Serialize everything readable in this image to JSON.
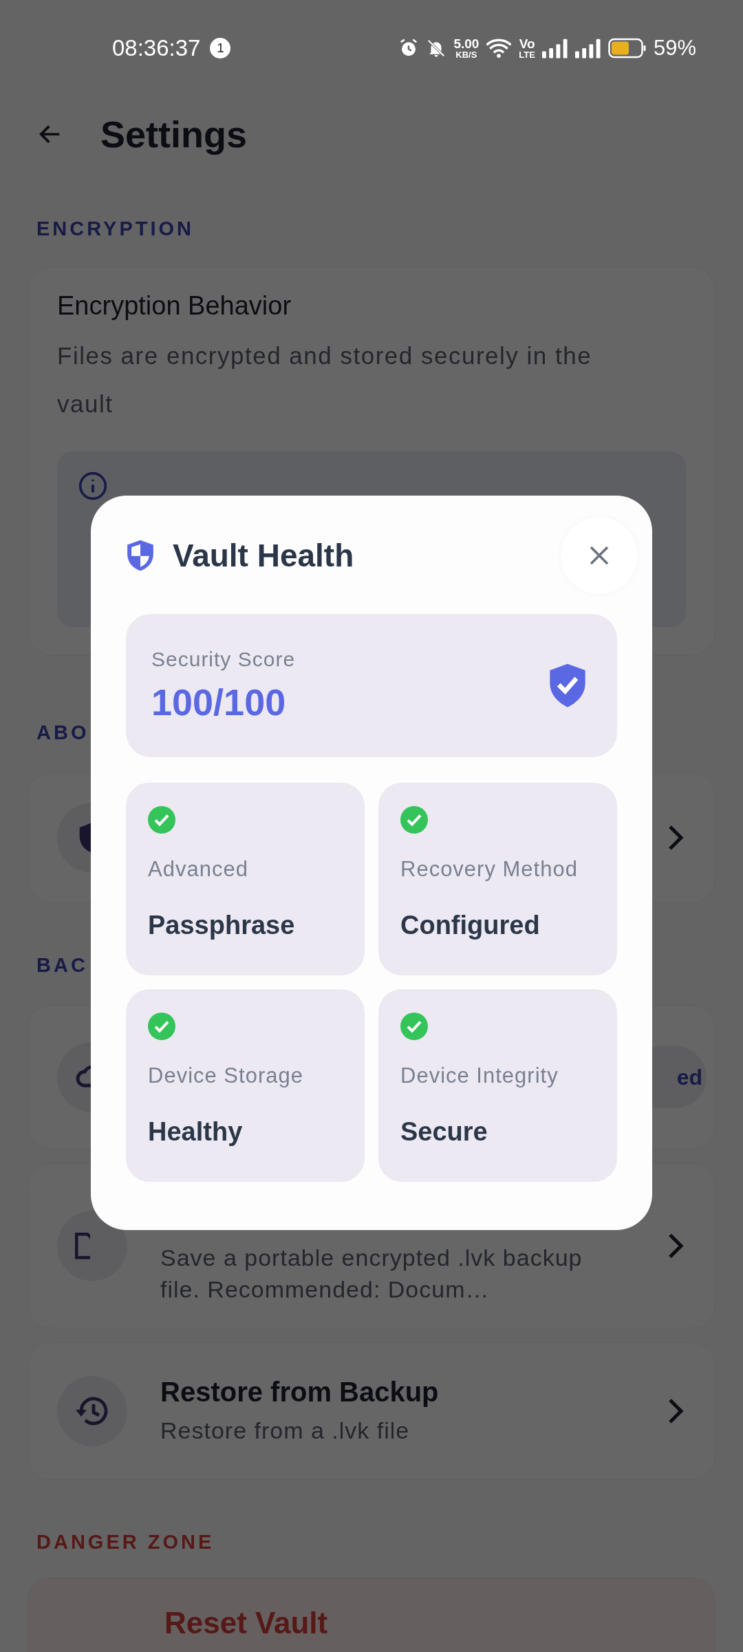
{
  "status_bar": {
    "time": "08:36:37",
    "notification_count": "1",
    "net_speed": "5.00",
    "net_speed_unit": "KB/S",
    "volte": "Vo",
    "volte_sub": "LTE",
    "battery": "59%"
  },
  "header": {
    "title": "Settings"
  },
  "encryption": {
    "section_title": "ENCRYPTION",
    "card_title": "Encryption Behavior",
    "card_text": "Files are encrypted and stored securely in the vault"
  },
  "about": {
    "section_title": "ABO"
  },
  "backup": {
    "section_title": "BAC",
    "badge": "ed",
    "items": [
      {
        "kind": "export",
        "description": "Save a portable encrypted .lvk backup file. Recommended: Docum…"
      },
      {
        "kind": "restore",
        "title": "Restore from Backup",
        "description": "Restore from a .lvk file"
      }
    ]
  },
  "danger_zone": {
    "section_title": "DANGER ZONE",
    "item_title": "Reset Vault"
  },
  "dialog": {
    "title": "Vault Health",
    "score_label": "Security Score",
    "score": "100/100",
    "checks": [
      {
        "label": "Advanced",
        "value": "Passphrase",
        "passed": true
      },
      {
        "label": "Recovery Method",
        "value": "Configured",
        "passed": true
      },
      {
        "label": "Device Storage",
        "value": "Healthy",
        "passed": true
      },
      {
        "label": "Device Integrity",
        "value": "Secure",
        "passed": true
      }
    ]
  }
}
